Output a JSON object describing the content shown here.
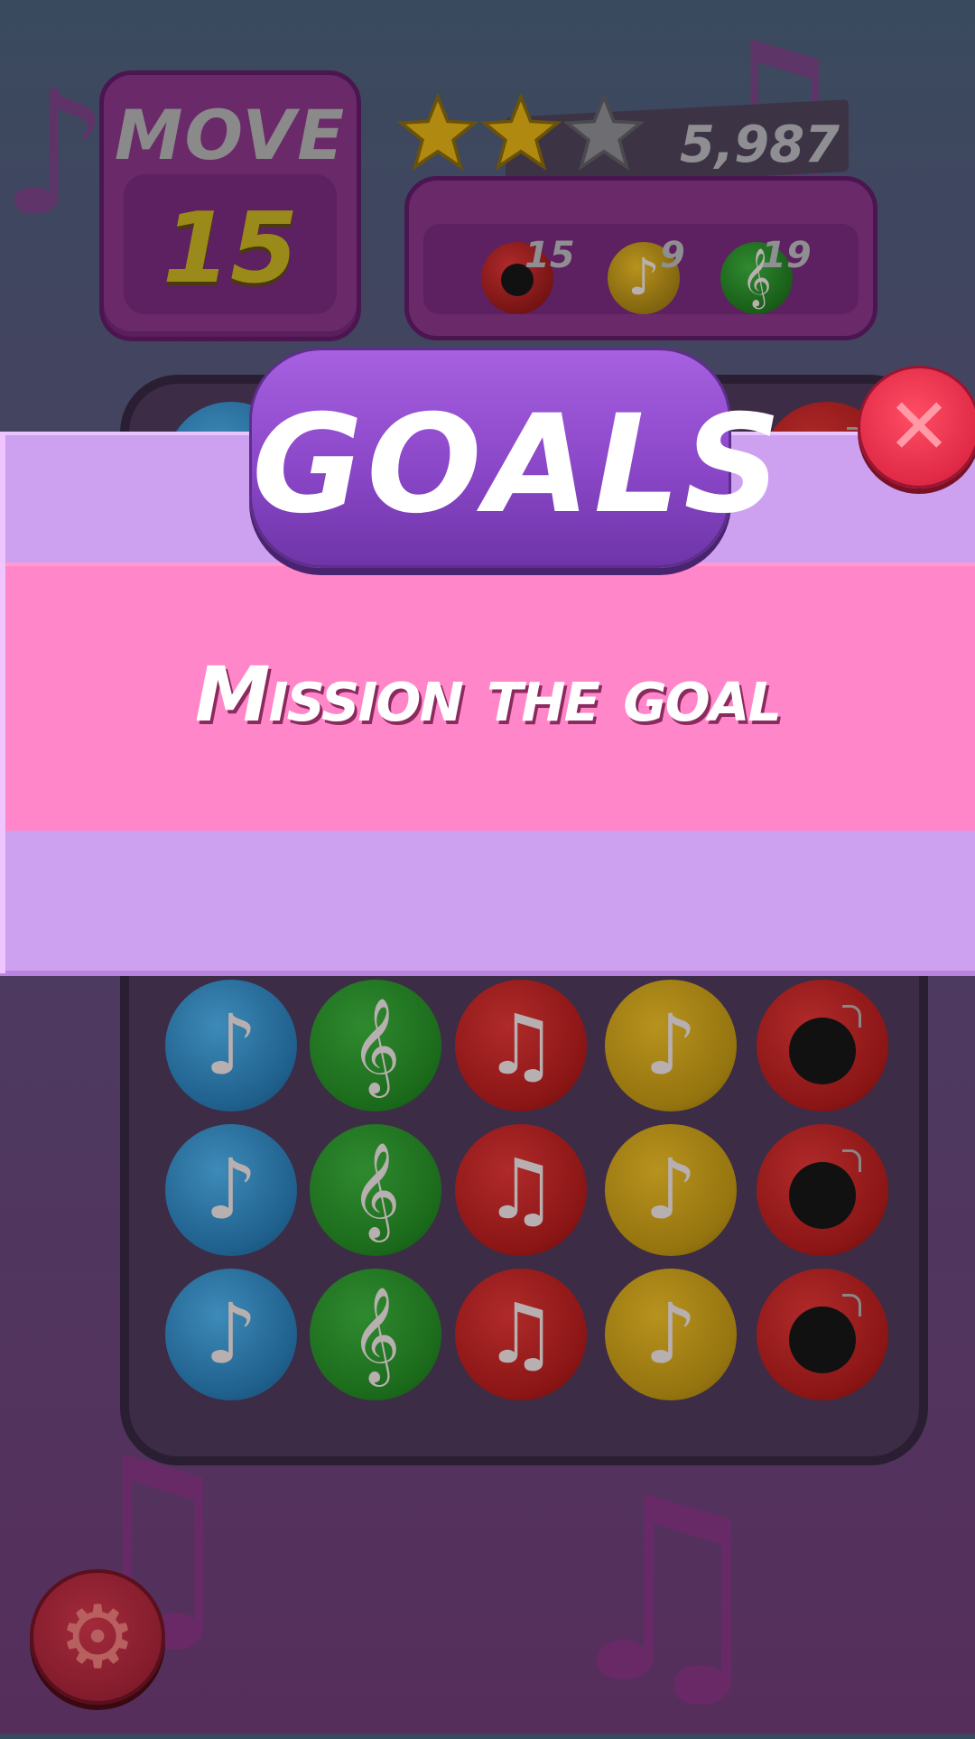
{
  "hud": {
    "move_label": "MOVE",
    "move_value": "15",
    "score": "5,987",
    "stars": {
      "earned": 2,
      "total": 3
    },
    "goals": [
      {
        "type": "bomb",
        "count": "15",
        "color": "#8a1515"
      },
      {
        "type": "note",
        "count": "9",
        "color": "#94740f"
      },
      {
        "type": "treble-clef",
        "count": "19",
        "color": "#1b6a1b"
      }
    ]
  },
  "overlay": {
    "title": "GOALS",
    "message": "Mission the goal",
    "close_glyph": "✕"
  },
  "board": {
    "rows": [
      [
        "blue-note",
        "green-clef",
        "red-notes",
        "yellow-note",
        "red-bomb"
      ],
      [
        "blue-note",
        "green-clef",
        "red-notes",
        "yellow-note",
        "red-bomb"
      ],
      [
        "blue-note",
        "green-clef",
        "red-notes",
        "yellow-note",
        "red-bomb"
      ]
    ]
  },
  "settings_icon": "gear-icon",
  "colors": {
    "purple_header": "#8a47c8",
    "pink_band": "#ff86c8",
    "lilac_band": "#cda1f0",
    "close_red": "#e02a47"
  }
}
